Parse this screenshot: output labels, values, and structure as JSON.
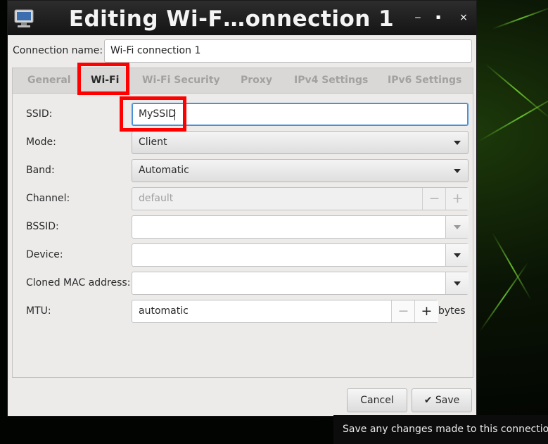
{
  "window": {
    "title": "Editing Wi-F…onnection 1",
    "controls": {
      "minimize": "‒",
      "maximize": "▪",
      "close": "×"
    }
  },
  "connection": {
    "label": "Connection name:",
    "value": "Wi-Fi connection 1"
  },
  "tabs": [
    {
      "label": "General",
      "active": false
    },
    {
      "label": "Wi-Fi",
      "active": true
    },
    {
      "label": "Wi-Fi Security",
      "active": false
    },
    {
      "label": "Proxy",
      "active": false
    },
    {
      "label": "IPv4 Settings",
      "active": false
    },
    {
      "label": "IPv6 Settings",
      "active": false
    }
  ],
  "wifi": {
    "ssid": {
      "label": "SSID:",
      "value": "MySSID"
    },
    "mode": {
      "label": "Mode:",
      "value": "Client"
    },
    "band": {
      "label": "Band:",
      "value": "Automatic"
    },
    "channel": {
      "label": "Channel:",
      "value": "default",
      "minus": "−",
      "plus": "+"
    },
    "bssid": {
      "label": "BSSID:",
      "value": ""
    },
    "device": {
      "label": "Device:",
      "value": ""
    },
    "cloned_mac": {
      "label": "Cloned MAC address:",
      "value": ""
    },
    "mtu": {
      "label": "MTU:",
      "value": "automatic",
      "minus": "−",
      "plus": "+",
      "unit": "bytes"
    }
  },
  "buttons": {
    "cancel": "Cancel",
    "save": "Save",
    "save_icon": "check-icon"
  },
  "tooltip": "Save any changes made to this connection.",
  "colors": {
    "highlight": "#ff0000",
    "focus": "#4a90d9",
    "titlebar": "#1e1e1e"
  }
}
